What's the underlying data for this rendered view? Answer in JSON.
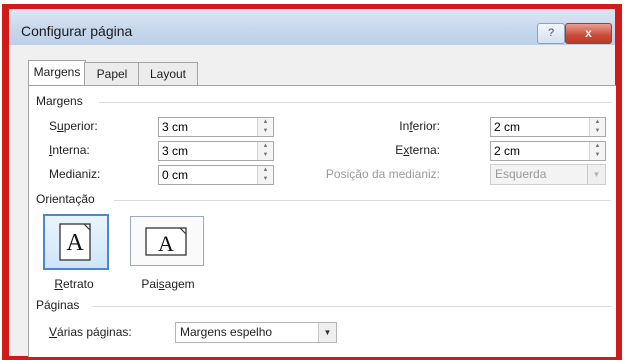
{
  "window": {
    "title": "Configurar página",
    "help_glyph": "?",
    "close_glyph": "x"
  },
  "tabs": [
    {
      "label": "Margens",
      "active": true
    },
    {
      "label": "Papel",
      "active": false
    },
    {
      "label": "Layout",
      "active": false
    }
  ],
  "margins": {
    "group_label": "Margens",
    "superior": {
      "label_prefix": "S",
      "label_ul": "u",
      "label_rest": "perior:",
      "value": "3 cm"
    },
    "inferior": {
      "label_prefix": "In",
      "label_ul": "f",
      "label_rest": "erior:",
      "value": "2 cm"
    },
    "interna": {
      "label_prefix": "",
      "label_ul": "I",
      "label_rest": "nterna:",
      "value": "3 cm"
    },
    "externa": {
      "label_prefix": "E",
      "label_ul": "x",
      "label_rest": "terna:",
      "value": "2 cm"
    },
    "medianiz": {
      "label_prefix": "Medianiz",
      "label_ul": "",
      "label_rest": ":",
      "value": "0 cm"
    },
    "posicao_medianiz": {
      "label": "Posição da medianiz:",
      "value": "Esquerda"
    }
  },
  "orientation": {
    "group_label": "Orientação",
    "glyph": "A",
    "retrato": {
      "label_ul": "R",
      "label_rest": "etrato"
    },
    "paisagem": {
      "label_prefix": "Pai",
      "label_ul": "s",
      "label_rest": "agem"
    }
  },
  "pages": {
    "group_label": "Páginas",
    "varias": {
      "label_ul": "V",
      "label_rest": "árias páginas:",
      "value": "Margens espelho"
    }
  },
  "colors": {
    "accent": "#4d87d0",
    "frame": "#d11a1a"
  }
}
